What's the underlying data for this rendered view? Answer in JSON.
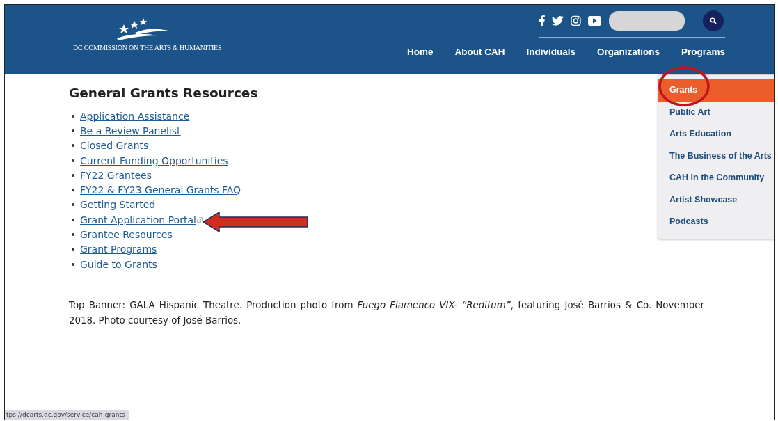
{
  "header": {
    "logo_text": "DC COMMISSION ON THE ARTS & HUMANITIES",
    "nav": [
      {
        "label": "Home"
      },
      {
        "label": "About CAH"
      },
      {
        "label": "Individuals"
      },
      {
        "label": "Organizations"
      },
      {
        "label": "Programs"
      }
    ]
  },
  "dropdown": {
    "items": [
      {
        "label": "Grants",
        "selected": true
      },
      {
        "label": "Public Art",
        "selected": false
      },
      {
        "label": "Arts Education",
        "selected": false
      },
      {
        "label": "The Business of the Arts",
        "selected": false
      },
      {
        "label": "CAH in the Community",
        "selected": false
      },
      {
        "label": "Artist Showcase",
        "selected": false
      },
      {
        "label": "Podcasts",
        "selected": false
      }
    ]
  },
  "content": {
    "heading": "General Grants Resources",
    "links": [
      {
        "label": "Application Assistance",
        "external": false
      },
      {
        "label": "Be a Review Panelist",
        "external": false
      },
      {
        "label": "Closed Grants",
        "external": false
      },
      {
        "label": "Current Funding Opportunities",
        "external": false
      },
      {
        "label": "FY22 Grantees",
        "external": false
      },
      {
        "label": "FY22 & FY23 General Grants FAQ",
        "external": false
      },
      {
        "label": "Getting Started",
        "external": false
      },
      {
        "label": "Grant Application Portal",
        "external": true
      },
      {
        "label": "Grantee Resources",
        "external": false
      },
      {
        "label": "Grant Programs",
        "external": false
      },
      {
        "label": "Guide to Grants",
        "external": false
      }
    ],
    "footnote": "Top Banner: GALA Hispanic Theatre. Production photo from *Fuego Flamenco VIX- “Reditum”*, featuring José Barrios & Co. November 2018. Photo courtesy of José Barrios."
  },
  "status_bar": {
    "url": "tps://dcarts.dc.gov/service/cah-grants"
  }
}
